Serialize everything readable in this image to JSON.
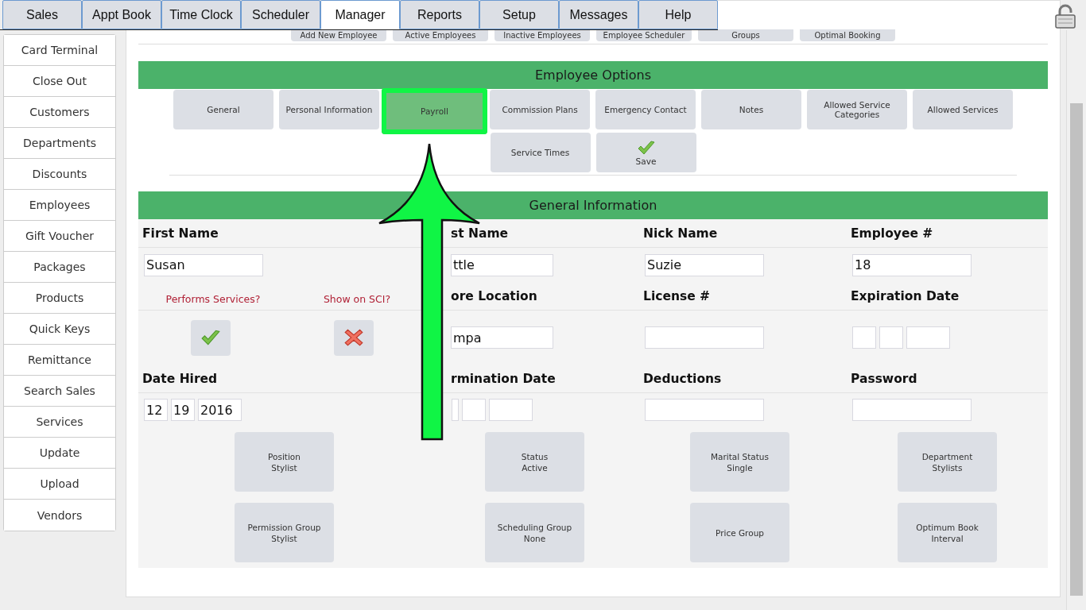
{
  "tabs": [
    {
      "label": "Sales",
      "selected": false
    },
    {
      "label": "Appt Book",
      "selected": false
    },
    {
      "label": "Time Clock",
      "selected": false
    },
    {
      "label": "Scheduler",
      "selected": false
    },
    {
      "label": "Manager",
      "selected": true
    },
    {
      "label": "Reports",
      "selected": false
    },
    {
      "label": "Setup",
      "selected": false
    },
    {
      "label": "Messages",
      "selected": false
    },
    {
      "label": "Help",
      "selected": false
    }
  ],
  "sidebar": {
    "items": [
      "Card Terminal",
      "Close Out",
      "Customers",
      "Departments",
      "Discounts",
      "Employees",
      "Gift Voucher",
      "Packages",
      "Products",
      "Quick Keys",
      "Remittance",
      "Search Sales",
      "Services",
      "Update",
      "Upload",
      "Vendors"
    ]
  },
  "sub_buttons": [
    "Add New Employee",
    "Active Employees",
    "Inactive Employees",
    "Employee Scheduler",
    "Groups",
    "Optimal Booking"
  ],
  "employee_options": {
    "title": "Employee Options",
    "buttons": [
      {
        "kind": "text",
        "label": "General",
        "selected": false
      },
      {
        "kind": "text",
        "label": "Personal Information",
        "selected": false
      },
      {
        "kind": "text",
        "label": "Payroll",
        "selected": true
      },
      {
        "kind": "text",
        "label": "Commission Plans",
        "selected": false
      },
      {
        "kind": "text",
        "label": "Emergency Contact",
        "selected": false
      },
      {
        "kind": "text",
        "label": "Notes",
        "selected": false
      },
      {
        "kind": "text",
        "label": "Allowed Service Categories",
        "selected": false
      },
      {
        "kind": "text",
        "label": "Allowed Services",
        "selected": false
      },
      {
        "kind": "text",
        "label": "Service Times",
        "selected": false
      },
      {
        "kind": "save",
        "label": "Save",
        "selected": false
      }
    ]
  },
  "general_information": {
    "title": "General Information",
    "sections": [
      [
        {
          "kind": "text",
          "label": "First Name",
          "value": "Susan"
        },
        {
          "kind": "text",
          "label": "st Name",
          "value": "ttle"
        },
        {
          "kind": "text",
          "label": "Nick Name",
          "value": "Suzie"
        },
        {
          "kind": "text",
          "label": "Employee #",
          "value": "18"
        }
      ],
      [
        {
          "kind": "toggles",
          "toggles": [
            {
              "label": "Performs Services?",
              "on": true
            },
            {
              "label": "Show on SCI?",
              "on": false
            }
          ]
        },
        {
          "kind": "text",
          "label": "ore Location",
          "value": "mpa"
        },
        {
          "kind": "text",
          "label": "License #"
        },
        {
          "kind": "date",
          "label": "Expiration Date"
        }
      ],
      [
        {
          "kind": "date",
          "label": "Date Hired",
          "month": "12",
          "day": "19",
          "year": "2016"
        },
        {
          "kind": "date",
          "label": "rmination Date"
        },
        {
          "kind": "text",
          "label": "Deductions"
        },
        {
          "kind": "password",
          "label": "Password"
        }
      ]
    ],
    "buttons": [
      {
        "title": "Position",
        "value": "Stylist"
      },
      {
        "title": "Status",
        "value": "Active"
      },
      {
        "title": "Marital Status",
        "value": "Single"
      },
      {
        "title": "Department",
        "value": "Stylists"
      },
      {
        "title": "Permission Group",
        "value": "Stylist"
      },
      {
        "title": "Scheduling Group",
        "value": "None"
      },
      {
        "title": "Price Group"
      },
      {
        "title": "Optimum Book",
        "value": "Interval"
      }
    ]
  }
}
